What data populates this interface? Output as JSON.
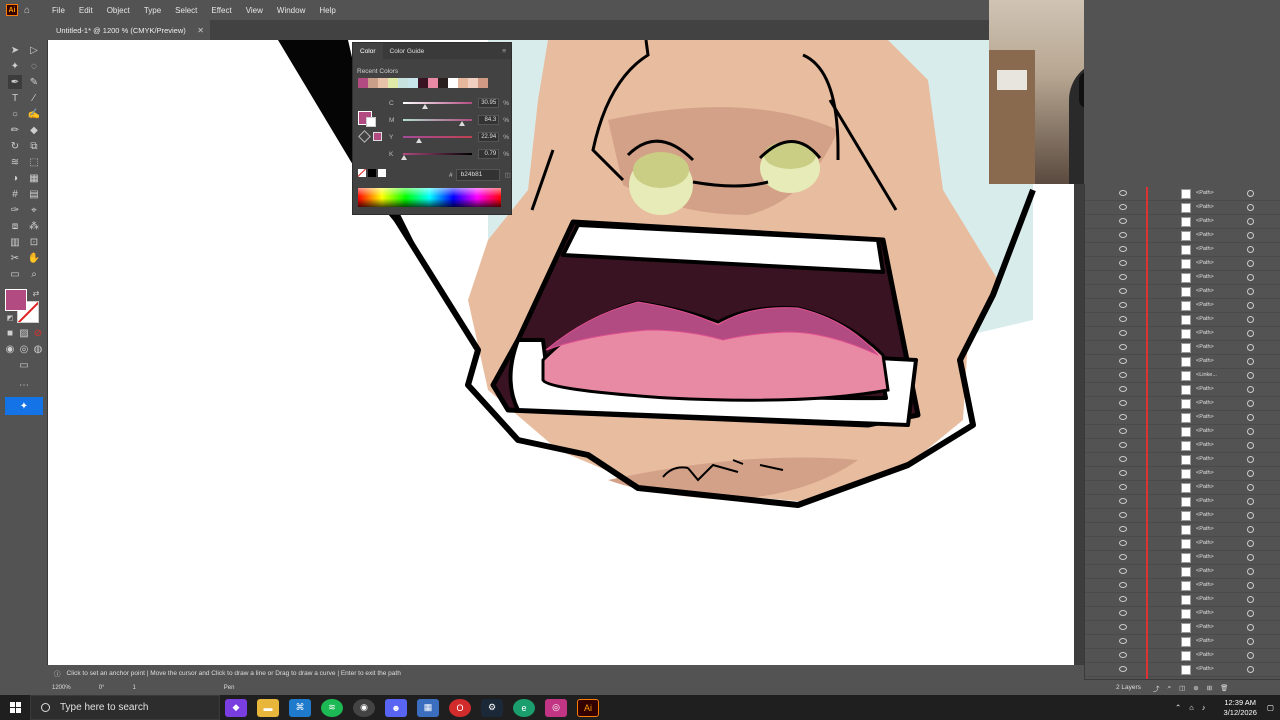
{
  "menubar": {
    "app_logo": "Ai",
    "items": [
      "File",
      "Edit",
      "Object",
      "Type",
      "Select",
      "Effect",
      "View",
      "Window",
      "Help"
    ]
  },
  "document_tab": {
    "title": "Untitled-1* @ 1200 % (CMYK/Preview)"
  },
  "color_panel": {
    "tabs": [
      "Color",
      "Color Guide"
    ],
    "recent_label": "Recent Colors",
    "recent_colors": [
      "#b24b81",
      "#c99f8a",
      "#e8c2a8",
      "#dfe9a8",
      "#c8e2df",
      "#c8e5ec",
      "#3a1322",
      "#e88aa4",
      "#2a1f1f",
      "#ffffff",
      "#e5b79c",
      "#f1d0c1",
      "#d09a84"
    ],
    "sliders": [
      {
        "label": "C",
        "value": "30.95",
        "fraction": 0.31,
        "gradient": "linear-gradient(to right,#fff,#b24b81)"
      },
      {
        "label": "M",
        "value": "84.3",
        "fraction": 0.843,
        "gradient": "linear-gradient(to right,#b0e0d0,#b24b81)"
      },
      {
        "label": "Y",
        "value": "22.94",
        "fraction": 0.23,
        "gradient": "linear-gradient(to right,#a34b9a,#c04050)"
      },
      {
        "label": "K",
        "value": "0.79",
        "fraction": 0.01,
        "gradient": "linear-gradient(to right,#b24b81,#000)"
      }
    ],
    "percent_sign": "%",
    "hex_symbol": "#",
    "hex_value": "b24b81"
  },
  "fill_color": "#b24b81",
  "status_bar": {
    "hint": "Click to set an anchor point  |  Move the cursor and Click to draw a line or Drag to draw a curve  |  Enter to exit the path"
  },
  "zoom_bar": {
    "zoom": "1200%",
    "rotate": "0°",
    "artboard": "1",
    "tool": "Pen"
  },
  "layers_panel": {
    "rows": [
      "<Path>",
      "<Path>",
      "<Path>",
      "<Path>",
      "<Path>",
      "<Path>",
      "<Path>",
      "<Path>",
      "<Path>",
      "<Path>",
      "<Path>",
      "<Path>",
      "<Path>",
      "<Linke...",
      "<Path>",
      "<Path>",
      "<Path>",
      "<Path>",
      "<Path>",
      "<Path>",
      "<Path>",
      "<Path>",
      "<Path>",
      "<Path>",
      "<Path>",
      "<Path>",
      "<Path>",
      "<Path>",
      "<Path>",
      "<Path>",
      "<Path>",
      "<Path>",
      "<Path>",
      "<Path>",
      "<Path>",
      "<Path>"
    ],
    "footer": "2 Layers"
  },
  "taskbar": {
    "search_placeholder": "Type here to search",
    "time": "12:39 AM",
    "date": "3/12/2026"
  }
}
